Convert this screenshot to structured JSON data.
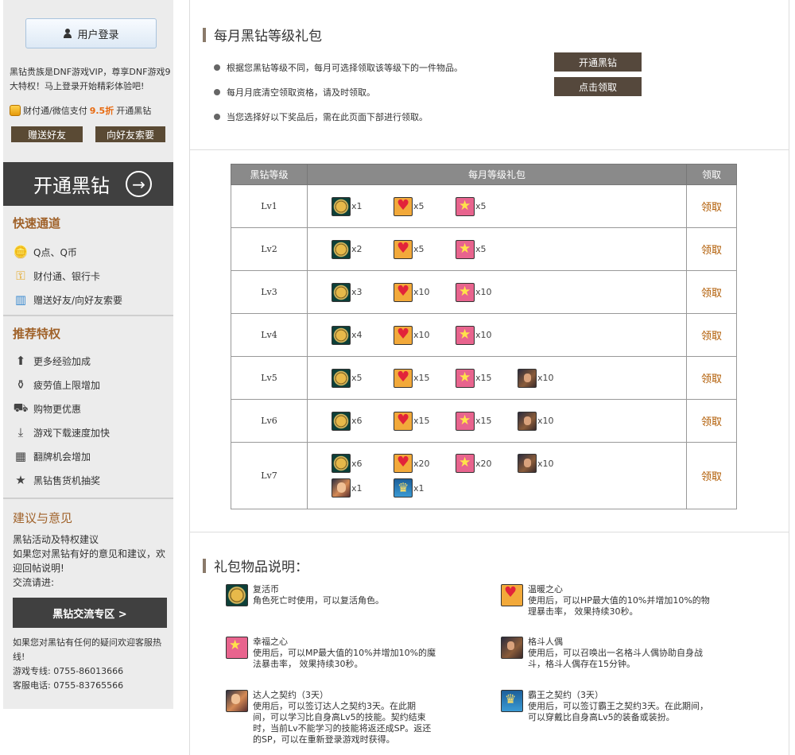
{
  "sidebar": {
    "login_label": "用户登录",
    "intro": "黑钻贵族是DNF游戏VIP，尊享DNF游戏9大特权！马上登录开始精彩体验吧!",
    "pay_promo": {
      "prefix": "财付通/微信支付",
      "discount": "9.5折",
      "suffix": "开通黑钻"
    },
    "gift_friend_label": "赠送好友",
    "ask_friend_label": "向好友索要",
    "banner_label": "开通黑钻",
    "quick_head": "快速通道",
    "quick_items": [
      {
        "label": "Q点、Q币",
        "icon": "coins-icon"
      },
      {
        "label": "财付通、银行卡",
        "icon": "key-icon"
      },
      {
        "label": "赠送好友/向好友索要",
        "icon": "gift-icon"
      }
    ],
    "priv_head": "推荐特权",
    "priv_items": [
      {
        "label": "更多经验加成",
        "icon": "upload-arrow-icon"
      },
      {
        "label": "疲劳值上限增加",
        "icon": "potion-icon"
      },
      {
        "label": "购物更优惠",
        "icon": "cart-icon"
      },
      {
        "label": "游戏下载速度加快",
        "icon": "download-icon"
      },
      {
        "label": "翻牌机会增加",
        "icon": "grid-icon"
      },
      {
        "label": "黑钻售货机抽奖",
        "icon": "star-icon"
      }
    ],
    "sugg_head": "建议与意见",
    "sugg_lines": [
      "黑钻活动及特权建议",
      "如果您对黑钻有好的意见和建议，欢迎回帖说明!",
      "交流请进:"
    ],
    "forum_label": "黑钻交流专区 >",
    "contact_lines": [
      "如果您对黑钻有任何的疑问欢迎客服热线!",
      "游戏专线: 0755-86013666",
      "客服电话: 0755-83765566"
    ]
  },
  "monthly": {
    "title": "每月黑钻等级礼包",
    "bullets": [
      "根据您黑钻等级不同，每月可选择领取该等级下的一件物品。",
      "每月月底清空领取资格，请及时领取。",
      "当您选择好以下奖品后，需在此页面下部进行领取。"
    ],
    "open_label": "开通黑钻",
    "claim_label": "点击领取"
  },
  "table": {
    "headers": [
      "黑钻等级",
      "每月等级礼包",
      "领取"
    ],
    "rows": [
      {
        "level": "Lv1",
        "action": "领取",
        "items": [
          {
            "icon": "revive",
            "qty": "x1"
          },
          {
            "icon": "warm",
            "qty": "x5"
          },
          {
            "icon": "happy",
            "qty": "x5"
          }
        ]
      },
      {
        "level": "Lv2",
        "action": "领取",
        "items": [
          {
            "icon": "revive",
            "qty": "x2"
          },
          {
            "icon": "warm",
            "qty": "x5"
          },
          {
            "icon": "happy",
            "qty": "x5"
          }
        ]
      },
      {
        "level": "Lv3",
        "action": "领取",
        "items": [
          {
            "icon": "revive",
            "qty": "x3"
          },
          {
            "icon": "warm",
            "qty": "x10"
          },
          {
            "icon": "happy",
            "qty": "x10"
          }
        ]
      },
      {
        "level": "Lv4",
        "action": "领取",
        "items": [
          {
            "icon": "revive",
            "qty": "x4"
          },
          {
            "icon": "warm",
            "qty": "x10"
          },
          {
            "icon": "happy",
            "qty": "x10"
          }
        ]
      },
      {
        "level": "Lv5",
        "action": "领取",
        "items": [
          {
            "icon": "revive",
            "qty": "x5"
          },
          {
            "icon": "warm",
            "qty": "x15"
          },
          {
            "icon": "happy",
            "qty": "x15"
          },
          {
            "icon": "doll",
            "qty": "x10"
          }
        ]
      },
      {
        "level": "Lv6",
        "action": "领取",
        "items": [
          {
            "icon": "revive",
            "qty": "x6"
          },
          {
            "icon": "warm",
            "qty": "x15"
          },
          {
            "icon": "happy",
            "qty": "x15"
          },
          {
            "icon": "doll",
            "qty": "x10"
          }
        ]
      },
      {
        "level": "Lv7",
        "action": "领取",
        "items": [
          {
            "icon": "revive",
            "qty": "x6"
          },
          {
            "icon": "warm",
            "qty": "x20"
          },
          {
            "icon": "happy",
            "qty": "x20"
          },
          {
            "icon": "doll",
            "qty": "x10"
          },
          {
            "icon": "expert",
            "qty": "x1"
          },
          {
            "icon": "overlord",
            "qty": "x1"
          }
        ]
      }
    ]
  },
  "descriptions": {
    "title": "礼包物品说明：",
    "items": [
      {
        "icon": "revive",
        "name": "复活币",
        "text": "角色死亡时使用，可以复活角色。"
      },
      {
        "icon": "warm",
        "name": "温暖之心",
        "text": "使用后，可以HP最大值的10%并增加10%的物理暴击率， 效果持续30秒。"
      },
      {
        "icon": "happy",
        "name": "幸福之心",
        "text": "使用后，可以MP最大值的10%并增加10%的魔法暴击率， 效果持续30秒。"
      },
      {
        "icon": "doll",
        "name": "格斗人偶",
        "text": "使用后，可以召唤出一名格斗人偶协助自身战斗，格斗人偶存在15分钟。"
      },
      {
        "icon": "expert",
        "name": "达人之契约（3天）",
        "text": "使用后，可以签订达人之契约3天。在此期间，可以学习比自身高Lv5的技能。契约结束时，当前Lv不能学习的技能将返还成SP。返还的SP，可以在重新登录游戏时获得。"
      },
      {
        "icon": "overlord",
        "name": "霸王之契约（3天）",
        "text": "使用后，可以签订霸王之契约3天。在此期间，可以穿戴比自身高Lv5的装备或装扮。"
      }
    ]
  },
  "colors": {
    "accent_brown": "#a0622a",
    "dark_button": "#404040",
    "claim_link": "#b05a00"
  }
}
